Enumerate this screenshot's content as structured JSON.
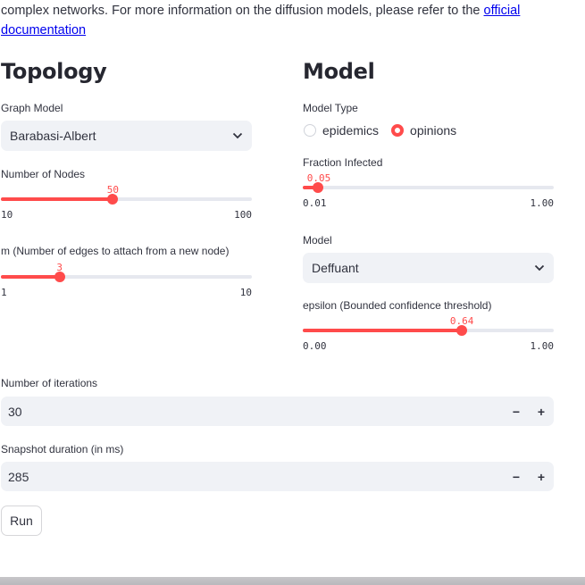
{
  "intro": {
    "text": "complex networks. For more information on the diffusion models, please refer to the ",
    "link_text_1": "official",
    "link_text_2": "documentation"
  },
  "topology": {
    "heading": "Topology",
    "graph_model": {
      "label": "Graph Model",
      "value": "Barabasi-Albert"
    },
    "nodes": {
      "label": "Number of Nodes",
      "value": "50",
      "min": "10",
      "max": "100",
      "fraction": 0.444
    },
    "m": {
      "label": "m (Number of edges to attach from a new node)",
      "value": "3",
      "min": "1",
      "max": "10",
      "fraction": 0.222
    }
  },
  "model": {
    "heading": "Model",
    "model_type": {
      "label": "Model Type",
      "options": [
        "epidemics",
        "opinions"
      ],
      "selected": "opinions"
    },
    "fraction_infected": {
      "label": "Fraction Infected",
      "value": "0.05",
      "min": "0.01",
      "max": "1.00",
      "fraction": 0.0404
    },
    "model_select": {
      "label": "Model",
      "value": "Deffuant"
    },
    "epsilon": {
      "label": "epsilon (Bounded confidence threshold)",
      "value": "0.64",
      "min": "0.00",
      "max": "1.00",
      "fraction": 0.64
    }
  },
  "iterations": {
    "label": "Number of iterations",
    "value": "30",
    "minus": "−",
    "plus": "+"
  },
  "snapshot": {
    "label": "Snapshot duration (in ms)",
    "value": "285",
    "minus": "−",
    "plus": "+"
  },
  "run_button": "Run",
  "colors": {
    "accent": "#ff4b4b",
    "input_bg": "#f0f2f6",
    "track": "#e6e8ef",
    "text": "#31333f",
    "link": "#0000ee"
  }
}
